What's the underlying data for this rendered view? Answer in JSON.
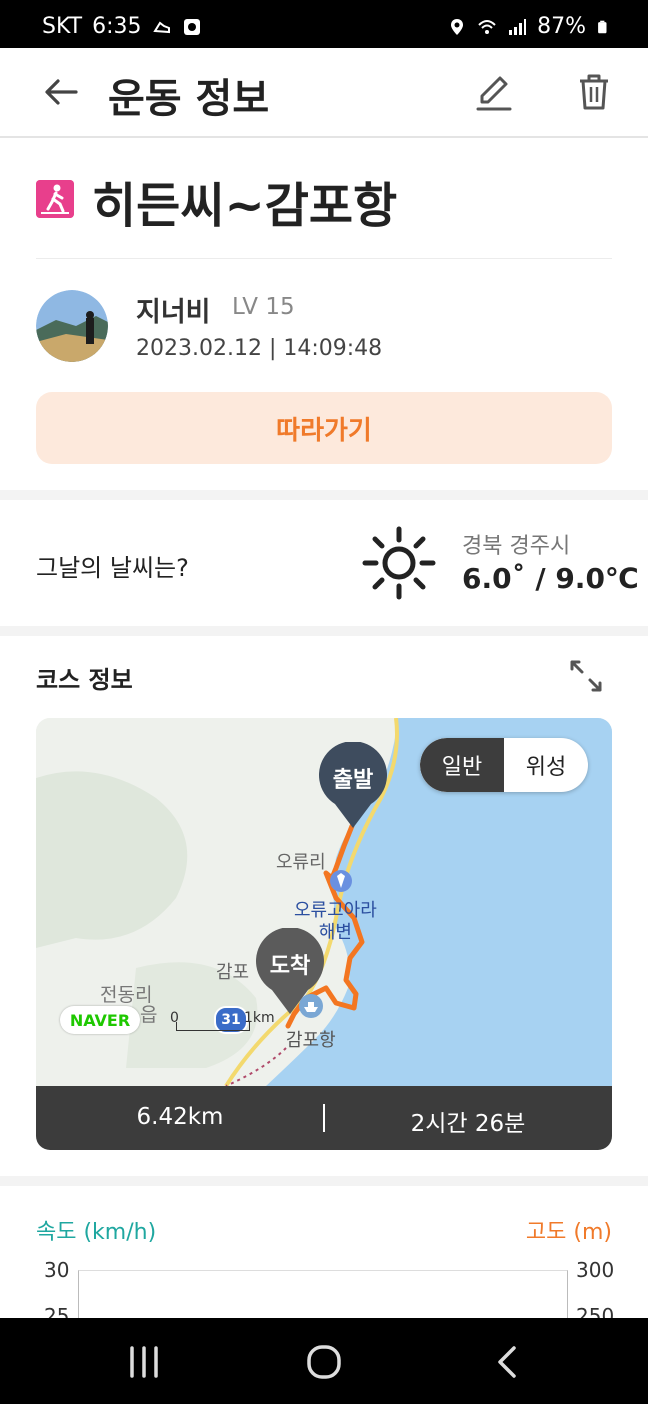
{
  "status": {
    "carrier": "SKT",
    "time": "6:35",
    "battery": "87%"
  },
  "header": {
    "title": "운동 정보",
    "back_icon": "arrow-left-icon",
    "edit_icon": "pencil-icon",
    "delete_icon": "trash-icon"
  },
  "activity": {
    "name": "히든씨~감포항",
    "type_icon": "walking-icon"
  },
  "user": {
    "name": "지너비",
    "level": "LV 15",
    "datetime": "2023.02.12 | 14:09:48"
  },
  "follow_label": "따라가기",
  "weather": {
    "question": "그날의 날씨는?",
    "location": "경북 경주시",
    "temperature": "6.0˚ / 9.0℃",
    "icon": "sun-icon"
  },
  "course": {
    "title": "코스 정보",
    "map": {
      "toggle": {
        "normal": "일반",
        "satellite": "위성"
      },
      "start_label": "출발",
      "end_label": "도착",
      "place_labels": {
        "oryu": "오류리",
        "beach": "오류고아라\n해변",
        "gampo_partial": "감포",
        "port": "감포항",
        "jeondong": "전동리",
        "eup": "읍"
      },
      "road_number": "31",
      "scale": {
        "zero": "0",
        "one": "1km"
      },
      "provider": "NAVER",
      "distance": "6.42km",
      "duration": "2시간 26분"
    }
  },
  "chart": {
    "speed_label": "속도 (km/h)",
    "altitude_label": "고도 (m)",
    "left_ticks": [
      "30",
      "25"
    ],
    "right_ticks": [
      "300",
      "250"
    ],
    "speed_color": "#1fa7a0",
    "altitude_color": "#f07a2a"
  },
  "accent_color": "#f07a2a"
}
